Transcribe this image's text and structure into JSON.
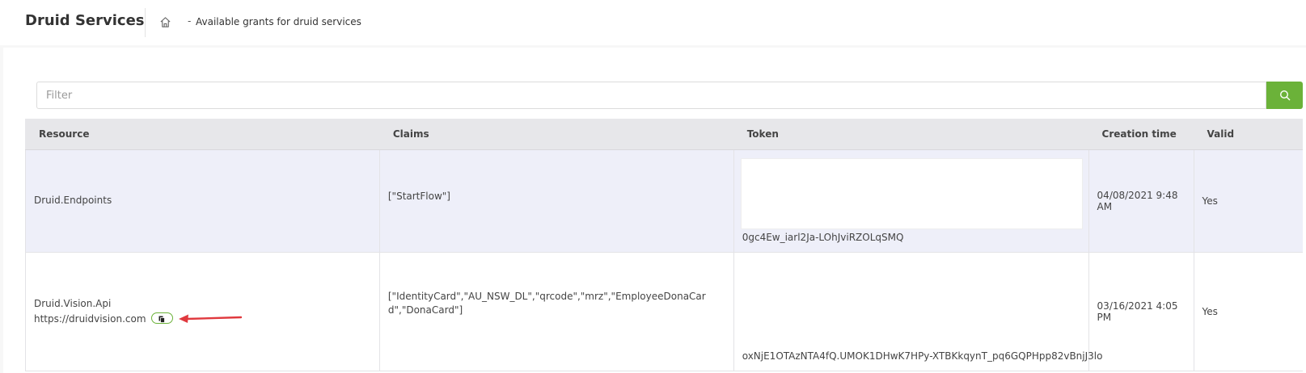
{
  "header": {
    "title": "Druid Services",
    "breadcrumb_separator": "-",
    "breadcrumb_current": "Available grants for druid services"
  },
  "filter": {
    "placeholder": "Filter",
    "value": ""
  },
  "table": {
    "columns": [
      "Resource",
      "Claims",
      "Token",
      "Creation time",
      "Valid"
    ],
    "rows": [
      {
        "resource": "Druid.Endpoints",
        "url": "",
        "claims": "[\"StartFlow\"]",
        "token": "0gc4Ew_iarl2Ja-LOhJviRZOLqSMQ",
        "creation_time": "04/08/2021 9:48 AM",
        "valid": "Yes"
      },
      {
        "resource": "Druid.Vision.Api",
        "url": "https://druidvision.com",
        "claims": "[\"IdentityCard\",\"AU_NSW_DL\",\"qrcode\",\"mrz\",\"EmployeeDonaCard\",\"DonaCard\"]",
        "token": "oxNjE1OTAzNTA4fQ.UMOK1DHwK7HPy-XTBKkqynT_pq6GQPHpp82vBnjJ3lo",
        "creation_time": "03/16/2021 4:05 PM",
        "valid": "Yes"
      }
    ]
  },
  "colors": {
    "accent_green": "#6bb239",
    "annotation_arrow": "#e0393e",
    "header_bg": "#e7e7ea",
    "row_highlight": "#eeeff9"
  },
  "icons": [
    "home-icon",
    "search-icon",
    "copy-icon",
    "annotation-arrow"
  ]
}
